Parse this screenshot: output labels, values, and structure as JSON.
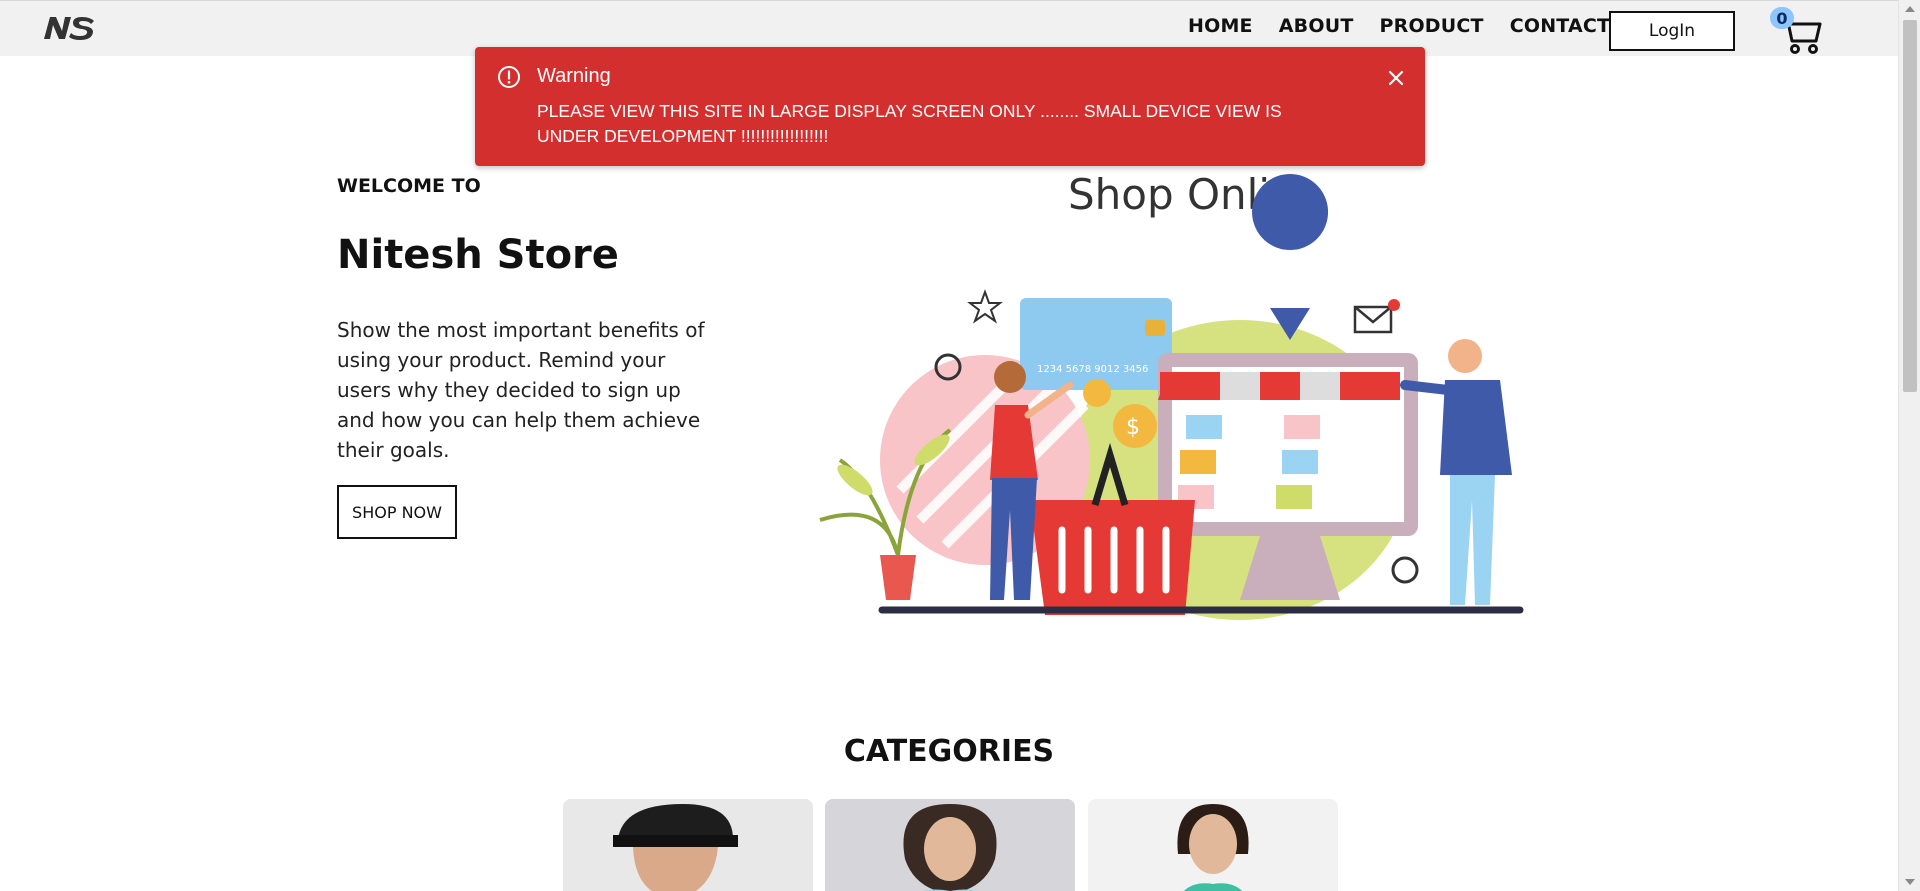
{
  "nav": {
    "links": [
      "HOME",
      "ABOUT",
      "PRODUCT",
      "CONTACT"
    ],
    "login_label": "LogIn",
    "cart_count": "0"
  },
  "toast": {
    "title": "Warning",
    "message": "PLEASE VIEW THIS SITE IN LARGE DISPLAY SCREEN ONLY ........ SMALL DEVICE VIEW IS UNDER DEVELOPMENT !!!!!!!!!!!!!!!!!!",
    "color": "#d32f2f"
  },
  "hero": {
    "welcome": "WELCOME TO",
    "title": "Nitesh Store",
    "description": "Show the most important benefits of using your product. Remind your users why they decided to sign up and how you can help them achieve their goals.",
    "cta_label": "SHOP NOW",
    "illustration_heading": "Shop Online"
  },
  "categories": {
    "title": "CATEGORIES",
    "items": [
      "men-category-image",
      "women-category-image",
      "kids-category-image"
    ]
  },
  "colors": {
    "accent": "#d32f2f",
    "badge": "#8ec5ff"
  }
}
